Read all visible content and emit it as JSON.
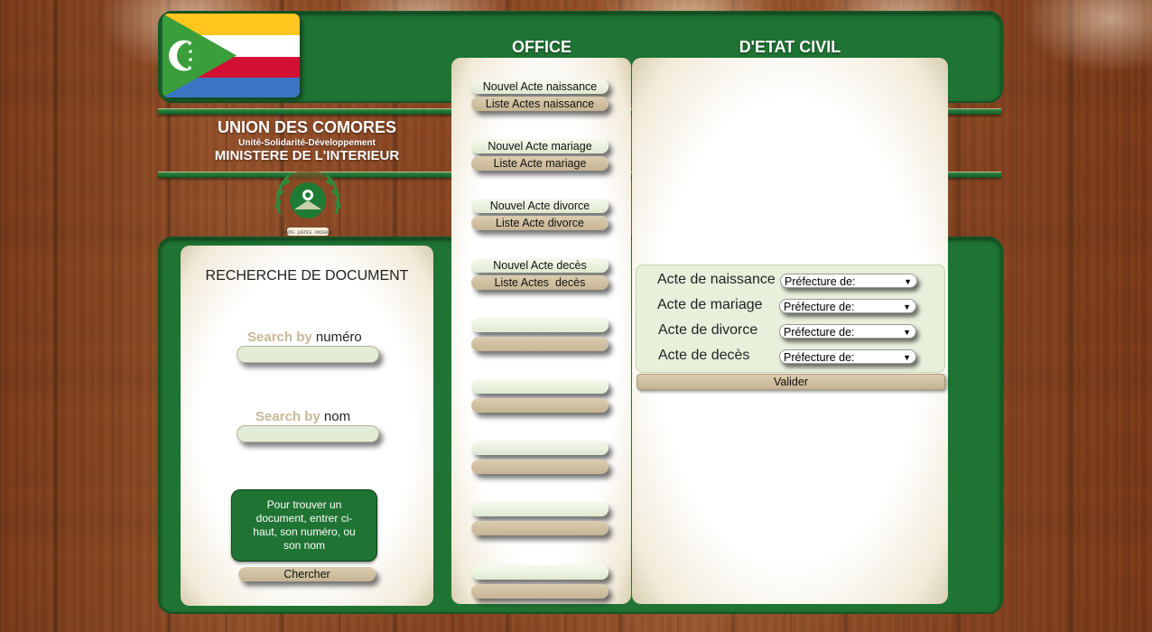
{
  "colors": {
    "green": "#1f7333",
    "pill_light": "#e3ecd6",
    "pill_tan": "#c9b795",
    "flag_yellow": "#ffc61e",
    "flag_white": "#ffffff",
    "flag_red": "#d21034",
    "flag_blue": "#3a75c4",
    "flag_triangle": "#3a9e3a"
  },
  "header": {
    "office_label": "OFFICE",
    "etat_civil_label": "D'ETAT CIVIL",
    "union_title": "UNION DES COMORES",
    "motto": "Unité-Solidarité-Développement",
    "ministry": "MINISTERE DE L'INTERIEUR",
    "flag_icon": "comoros-flag-icon",
    "emblem_icon": "comoros-coat-of-arms-icon"
  },
  "search": {
    "title": "RECHERCHE DE DOCUMENT",
    "search_by": "Search by",
    "field1_label": "numéro",
    "field2_label": "nom",
    "info_text": "Pour trouver un document, entrer ci-haut, son numéro, ou son nom",
    "button_label": "Chercher"
  },
  "office_menu": {
    "nouvel_naissance": "Nouvel Acte naissance",
    "liste_naissance": "Liste Actes naissance",
    "nouvel_mariage": "Nouvel Acte mariage",
    "liste_mariage": "Liste Acte mariage",
    "nouvel_divorce": "Nouvel Acte divorce",
    "liste_divorce": "Liste Acte divorce",
    "nouvel_deces": "Nouvel Acte decès",
    "liste_deces": "Liste Actes  decès"
  },
  "prefecture_form": {
    "row1_label": "Acte de naissance",
    "row2_label": "Acte de mariage",
    "row3_label": "Acte de divorce",
    "row4_label": "Acte de decès",
    "select_value": "Préfecture de:",
    "button_label": "Valider"
  }
}
